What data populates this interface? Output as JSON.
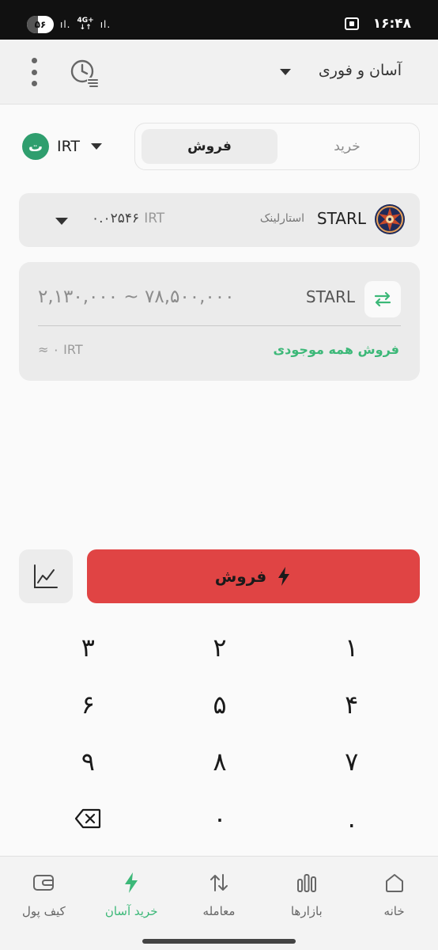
{
  "statusbar": {
    "battery": "۵۶",
    "signal_1": "ıl.",
    "network_top": "4G+",
    "network_bottom": "↓↑",
    "signal_2": "ıl.",
    "time": "۱۶:۴۸"
  },
  "header": {
    "title": "آسان و فوری"
  },
  "currency": {
    "label": "IRT",
    "logo_glyph": "ت"
  },
  "tabs": [
    {
      "label": "خرید",
      "active": false
    },
    {
      "label": "فروش",
      "active": true
    }
  ],
  "asset": {
    "symbol": "STARL",
    "name": "استارلینک",
    "price_currency": "IRT",
    "price": "۰.۰۲۵۴۶"
  },
  "amount": {
    "symbol": "STARL",
    "range": "۲,۱۳۰,۰۰۰ ~ ۷۸,۵۰۰,۰۰۰",
    "sell_all": "فروش همه موجودی",
    "approx": "≈ ۰ IRT"
  },
  "actions": {
    "sell_label": "فروش"
  },
  "keypad": {
    "keys": [
      "۳",
      "۲",
      "۱",
      "۶",
      "۵",
      "۴",
      "۹",
      "۸",
      "۷",
      "backspace",
      "۰",
      "."
    ]
  },
  "nav": [
    {
      "label": "خانه",
      "icon": "home-icon",
      "active": false
    },
    {
      "label": "بازارها",
      "icon": "markets-icon",
      "active": false
    },
    {
      "label": "معامله",
      "icon": "trade-icon",
      "active": false
    },
    {
      "label": "خرید آسان",
      "icon": "bolt-icon",
      "active": true
    },
    {
      "label": "کیف پول",
      "icon": "wallet-icon",
      "active": false
    }
  ],
  "colors": {
    "accent_green": "#3cb878",
    "sell_red": "#e04444",
    "card_bg": "#ebebeb"
  }
}
